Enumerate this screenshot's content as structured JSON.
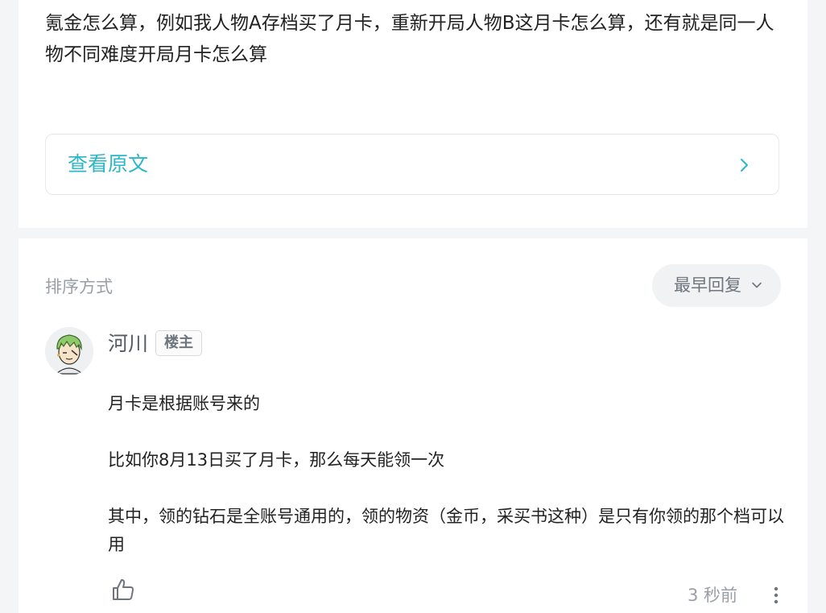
{
  "post": {
    "body": "氪金怎么算，例如我人物A存档买了月卡，重新开局人物B这月卡怎么算，还有就是同一人物不同难度开局月卡怎么算",
    "view_original_label": "查看原文"
  },
  "replies_section": {
    "sort_label": "排序方式",
    "sort_selected": "最早回复"
  },
  "reply": {
    "username": "河川",
    "badge": "楼主",
    "paragraphs": [
      "月卡是根据账号来的",
      "比如你8月13日买了月卡，那么每天能领一次",
      "其中，领的钻石是全账号通用的，领的物资（金币，采买书这种）是只有你领的那个档可以用"
    ],
    "timestamp": "3 秒前"
  },
  "icons": {
    "view_original": "chevron-right-icon",
    "sort": "chevron-down-icon",
    "like": "thumbs-up-icon",
    "more": "more-vertical-icon"
  },
  "colors": {
    "accent": "#2ab7c8",
    "muted_text": "#9a9fa6",
    "page_background": "#f3f5f7"
  }
}
